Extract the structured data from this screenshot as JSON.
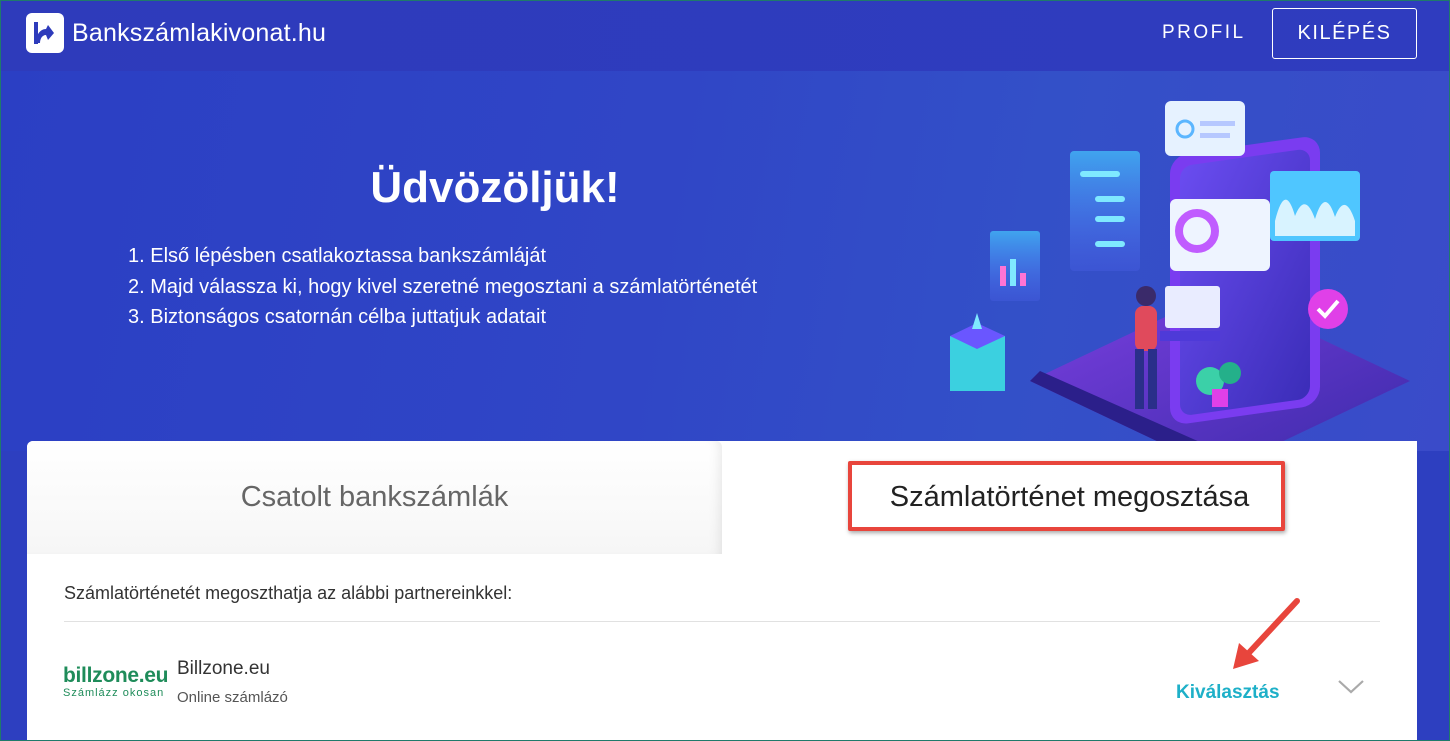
{
  "header": {
    "brand": "Bankszámlakivonat.hu",
    "nav_profile": "PROFIL",
    "nav_logout": "KILÉPÉS"
  },
  "hero": {
    "title": "Üdvözöljük!",
    "steps": [
      "1. Első lépésben csatlakoztassa bankszámláját",
      "2. Majd válassza ki, hogy kivel szeretné megosztani a számlatörténetét",
      "3. Biztonságos csatornán célba juttatjuk adatait"
    ]
  },
  "tabs": [
    {
      "label": "Csatolt bankszámlák",
      "active": false
    },
    {
      "label": "Számlatörténet megosztása",
      "active": true
    }
  ],
  "share": {
    "intro": "Számlatörténetét megoszthatja az alábbi partnereinkkel:",
    "partners": [
      {
        "logo_main": "billzone.eu",
        "logo_sub": "Számlázz okosan",
        "name": "Billzone.eu",
        "type": "Online számlázó",
        "action": "Kiválasztás",
        "expand_icon": "chevron-down-icon"
      }
    ]
  },
  "colors": {
    "header_bg": "#2e3bbb",
    "hero_bg": "#3046c6",
    "accent_link": "#1eb0c8",
    "highlight": "#e8453c",
    "logo_green": "#1f8c5a"
  }
}
